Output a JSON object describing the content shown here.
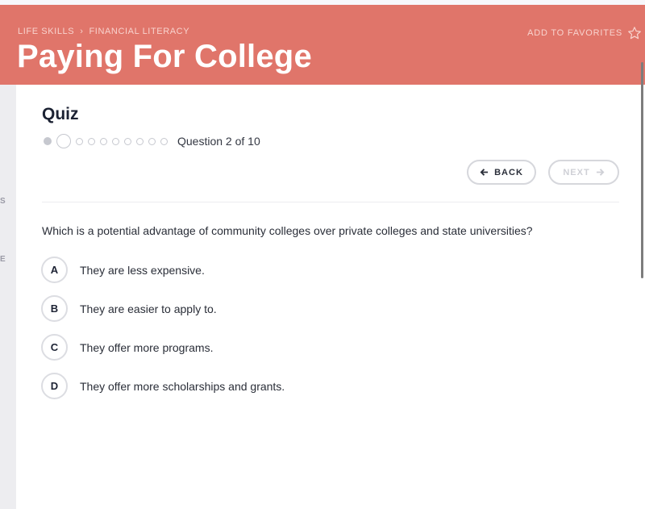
{
  "header": {
    "breadcrumb": [
      "LIFE SKILLS",
      "FINANCIAL LITERACY"
    ],
    "breadcrumb_separator": "›",
    "title": "Paying For College",
    "favorites_label": "ADD TO FAVORITES",
    "favorites_icon": "star-outline-icon",
    "accent_color": "#e0756a"
  },
  "sidebar": {
    "partial_letters": [
      "S",
      "E"
    ]
  },
  "quiz": {
    "title": "Quiz",
    "progress": {
      "current": 2,
      "total": 10,
      "label": "Question 2 of 10"
    },
    "back_label": "BACK",
    "next_label": "NEXT",
    "question": "Which is a potential advantage of community colleges over private colleges and state universities?",
    "answers": [
      {
        "letter": "A",
        "text": "They are less expensive."
      },
      {
        "letter": "B",
        "text": "They are easier to apply to."
      },
      {
        "letter": "C",
        "text": "They offer more programs."
      },
      {
        "letter": "D",
        "text": "They offer more scholarships and grants."
      }
    ]
  }
}
